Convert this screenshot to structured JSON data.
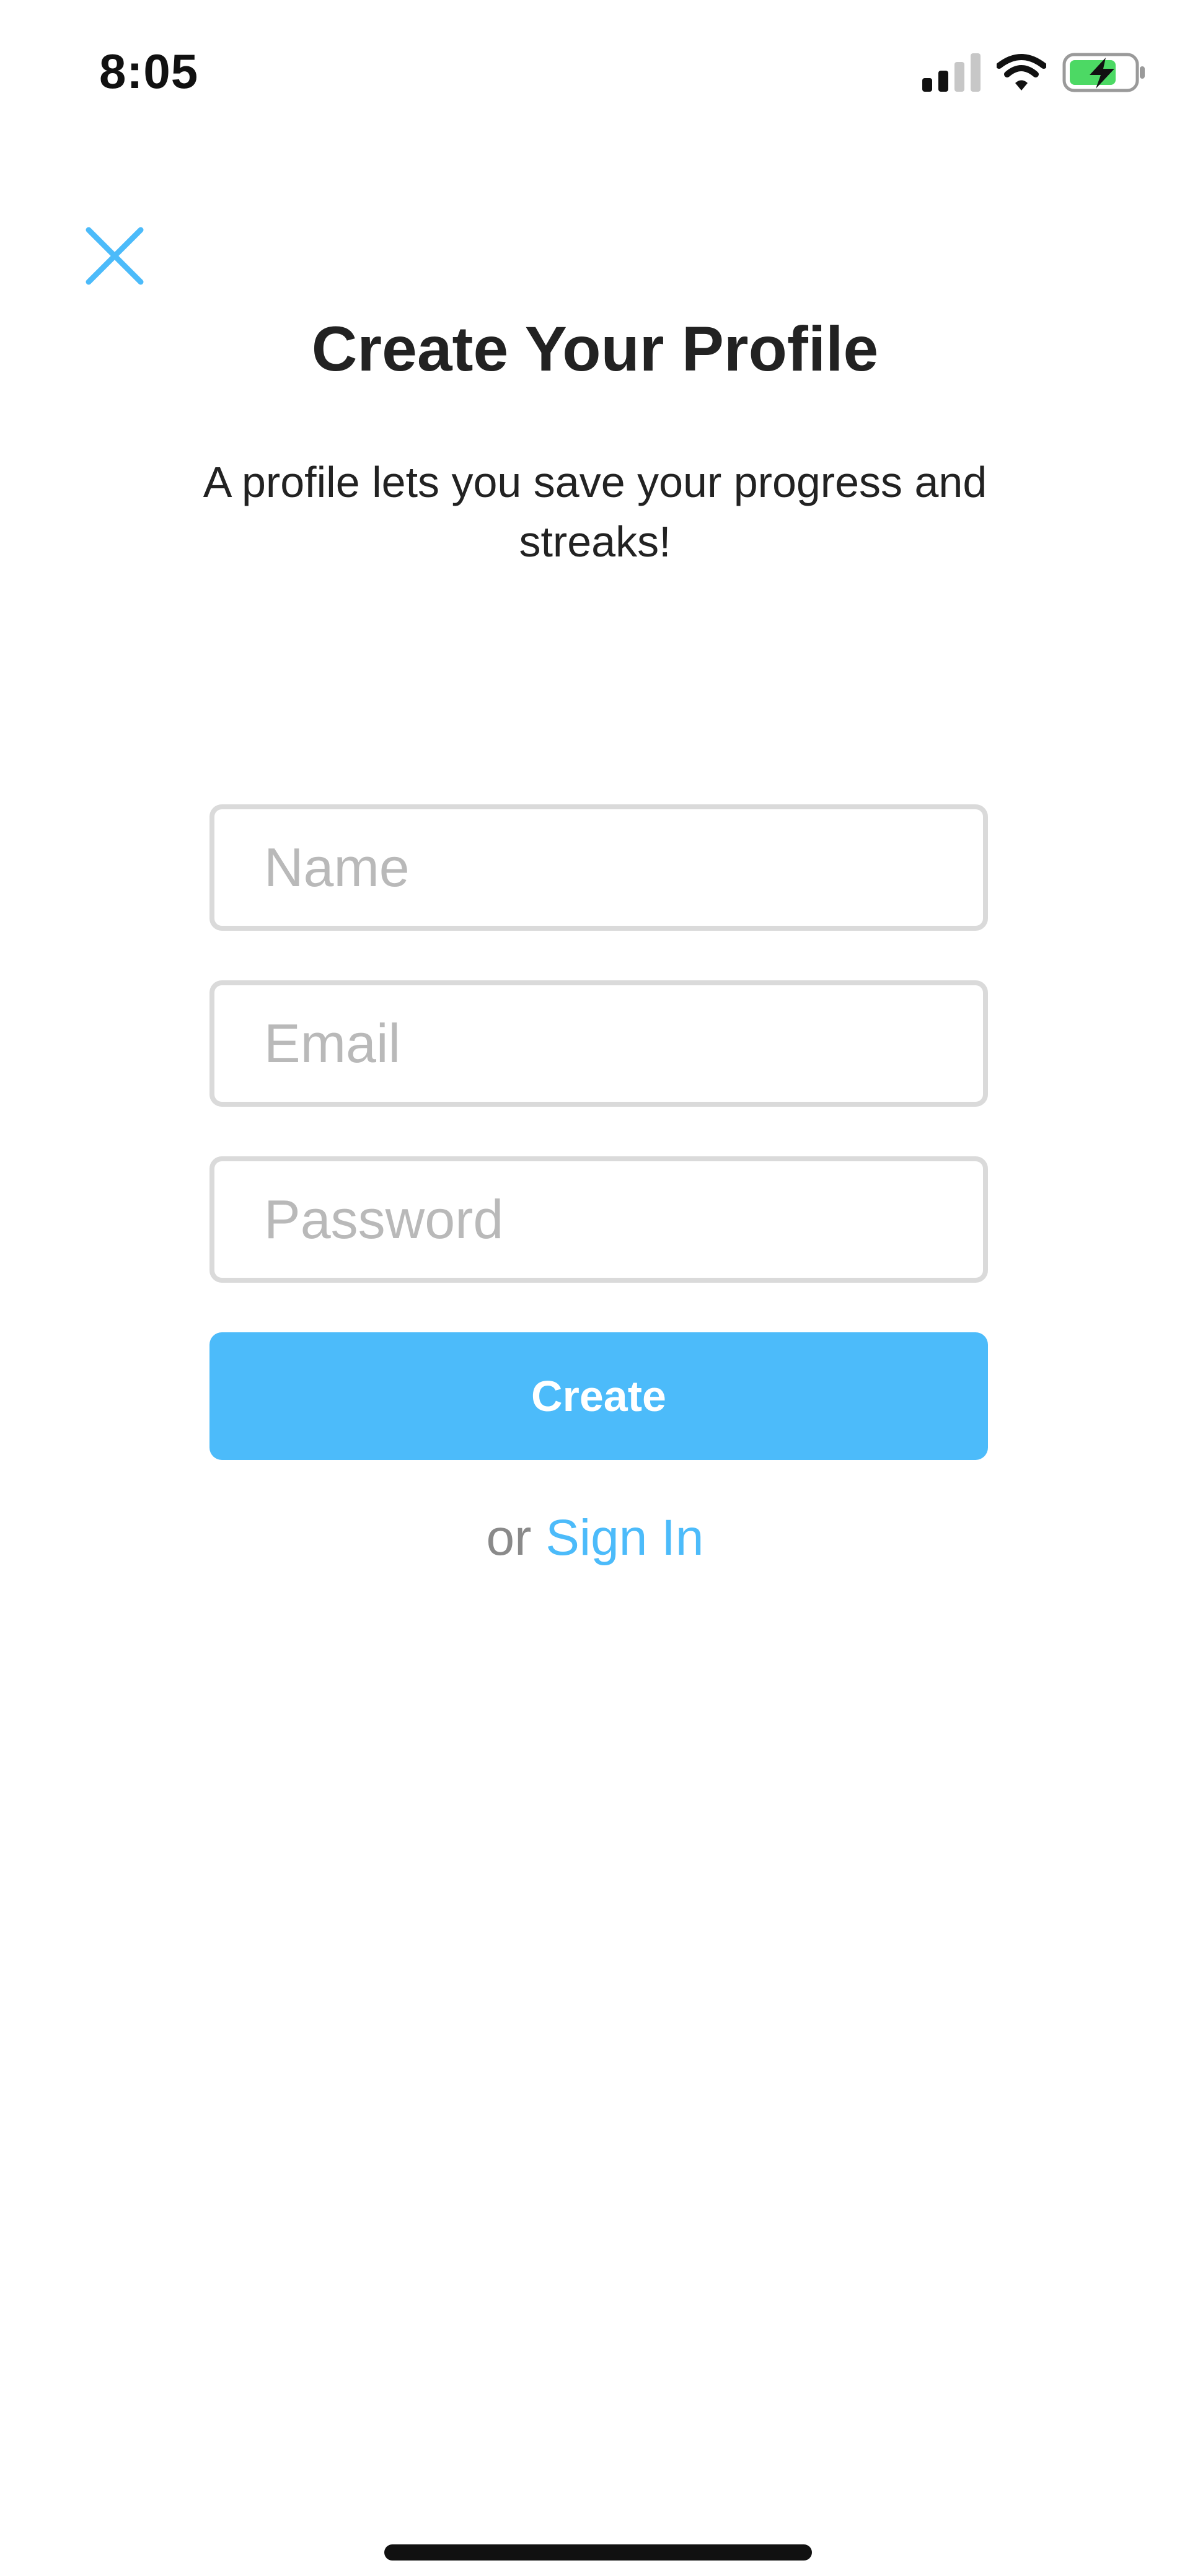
{
  "status_bar": {
    "time": "8:05",
    "icons": [
      "signal-icon",
      "wifi-icon",
      "battery-charging-icon"
    ]
  },
  "header": {
    "close_icon": "close-icon",
    "title": "Create Your Profile",
    "subtitle": "A profile lets you save your progress and streaks!"
  },
  "form": {
    "name_placeholder": "Name",
    "name_value": "",
    "email_placeholder": "Email",
    "email_value": "",
    "password_placeholder": "Password",
    "password_value": "",
    "create_label": "Create"
  },
  "footer": {
    "or_label": "or",
    "signin_label": "Sign In"
  },
  "colors": {
    "accent": "#4cbbfa",
    "field_border": "#dadada",
    "placeholder": "#b9b9b9",
    "battery_fill": "#4cd964"
  }
}
